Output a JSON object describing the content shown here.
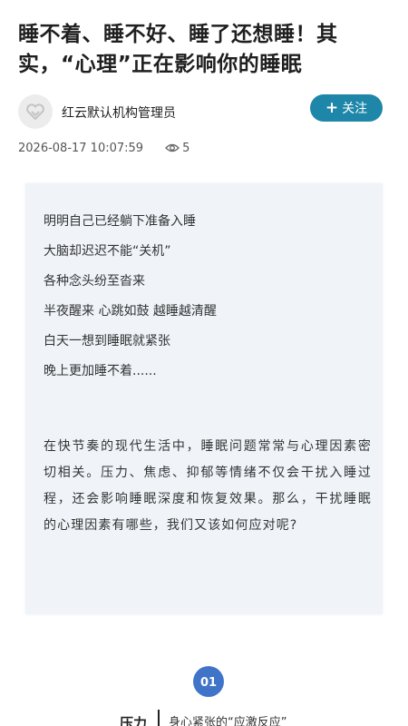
{
  "article": {
    "title": "睡不着、睡不好、睡了还想睡！其实，“心理”正在影响你的睡眠"
  },
  "author": {
    "name": "红云默认机构管理员",
    "follow_label": "关注",
    "avatar_icon": "heart-logo-icon"
  },
  "meta": {
    "timestamp": "2026-08-17 10:07:59",
    "views": "5",
    "views_icon": "eye-icon"
  },
  "content": {
    "poem_lines": [
      "明明自己已经躺下准备入睡",
      "大脑却迟迟不能“关机”",
      "各种念头纷至沓来",
      "半夜醒来 心跳如鼓 越睡越清醒",
      "白天一想到睡眠就紧张",
      "晚上更加睡不着......"
    ],
    "paragraph": "在快节奏的现代生活中，睡眠问题常常与心理因素密切相关。压力、焦虑、抑郁等情绪不仅会干扰入睡过程，还会影响睡眠深度和恢复效果。那么，干扰睡眠的心理因素有哪些，我们又该如何应对呢?"
  },
  "section": {
    "number": "01",
    "label": "压力",
    "subtitle": "身心紧张的“应激反应”"
  },
  "colors": {
    "follow_button": "#1e86a8",
    "card_background": "#f0f4f9",
    "section_badge": "#3f74c9"
  }
}
